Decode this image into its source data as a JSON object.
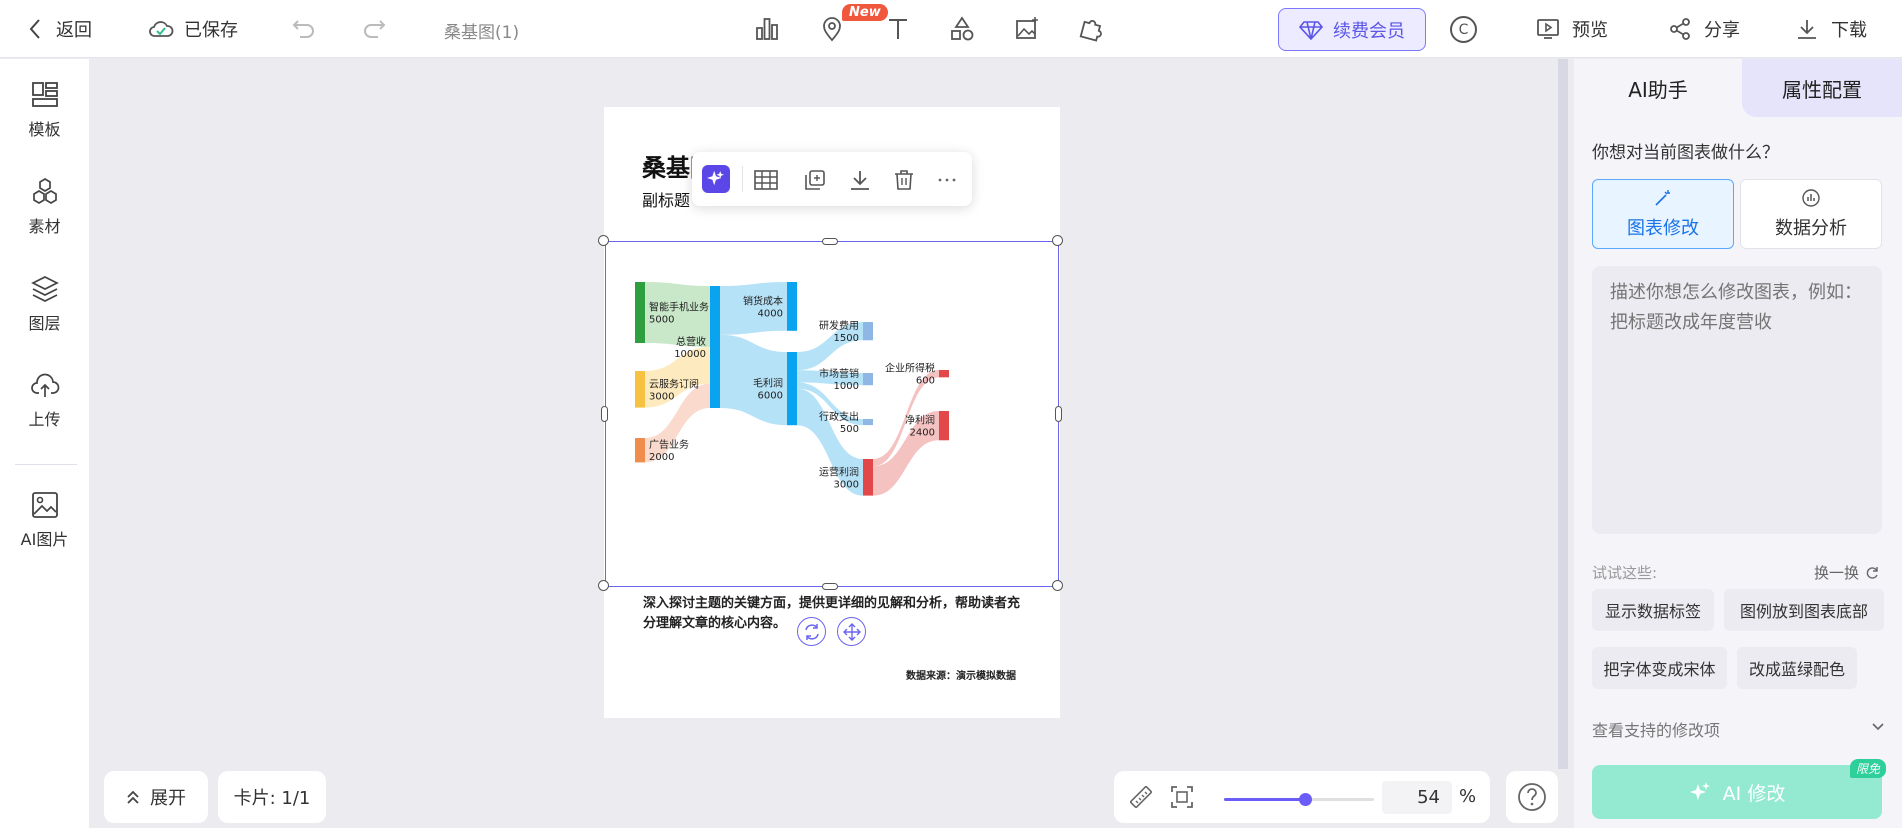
{
  "topbar": {
    "back_label": "返回",
    "saved_label": "已保存",
    "doc_name": "桑基图(1)",
    "new_badge": "New",
    "vip_label": "续费会员",
    "copyright_symbol": "C",
    "preview_label": "预览",
    "share_label": "分享",
    "download_label": "下载",
    "tools": [
      "chart-icon",
      "map-pin-icon",
      "text-icon",
      "shapes-icon",
      "image-add-icon",
      "puzzle-icon"
    ]
  },
  "sidebar": {
    "items": [
      {
        "label": "模板",
        "icon": "template-icon"
      },
      {
        "label": "素材",
        "icon": "hexagons-icon"
      },
      {
        "label": "图层",
        "icon": "layers-icon"
      },
      {
        "label": "上传",
        "icon": "cloud-upload-icon"
      },
      {
        "label": "AI图片",
        "icon": "image-icon"
      }
    ]
  },
  "canvas": {
    "title": "桑基图",
    "subtitle": "副标题",
    "description": "深入探讨主题的关键方面，提供更详细的见解和分析，帮助读者充分理解文章的核心内容。",
    "source": "数据来源：演示模拟数据"
  },
  "chart_data": {
    "type": "sankey",
    "title": "桑基图",
    "subtitle": "副标题",
    "nodes": [
      {
        "name": "智能手机业务",
        "value": 5000,
        "color": "#2e9e3e"
      },
      {
        "name": "云服务订阅",
        "value": 3000,
        "color": "#f7c242"
      },
      {
        "name": "广告业务",
        "value": 2000,
        "color": "#ef8d4e"
      },
      {
        "name": "总营收",
        "value": 10000,
        "color": "#0aa3ef"
      },
      {
        "name": "销货成本",
        "value": 4000,
        "color": "#0aa3ef"
      },
      {
        "name": "毛利润",
        "value": 6000,
        "color": "#0aa3ef"
      },
      {
        "name": "研发费用",
        "value": 1500,
        "color": "#8fb7e6"
      },
      {
        "name": "市场营销",
        "value": 1000,
        "color": "#8fb7e6"
      },
      {
        "name": "行政支出",
        "value": 500,
        "color": "#8fb7e6"
      },
      {
        "name": "运营利润",
        "value": 3000,
        "color": "#e2474a"
      },
      {
        "name": "企业所得税",
        "value": 600,
        "color": "#e2474a"
      },
      {
        "name": "净利润",
        "value": 2400,
        "color": "#e2474a"
      }
    ],
    "links": [
      {
        "source": "智能手机业务",
        "target": "总营收",
        "value": 5000
      },
      {
        "source": "云服务订阅",
        "target": "总营收",
        "value": 3000
      },
      {
        "source": "广告业务",
        "target": "总营收",
        "value": 2000
      },
      {
        "source": "总营收",
        "target": "销货成本",
        "value": 4000
      },
      {
        "source": "总营收",
        "target": "毛利润",
        "value": 6000
      },
      {
        "source": "毛利润",
        "target": "研发费用",
        "value": 1500
      },
      {
        "source": "毛利润",
        "target": "市场营销",
        "value": 1000
      },
      {
        "source": "毛利润",
        "target": "行政支出",
        "value": 500
      },
      {
        "source": "毛利润",
        "target": "运营利润",
        "value": 3000
      },
      {
        "source": "运营利润",
        "target": "企业所得税",
        "value": 600
      },
      {
        "source": "运营利润",
        "target": "净利润",
        "value": 2400
      }
    ]
  },
  "bottombar": {
    "expand_label": "展开",
    "card_label": "卡片: 1/1",
    "zoom_value": "54",
    "zoom_fraction": 0.54,
    "zoom_unit": "%"
  },
  "rightpanel": {
    "tab_ai": "AI助手",
    "tab_props": "属性配置",
    "question": "你想对当前图表做什么？",
    "mode_edit": "图表修改",
    "mode_analyze": "数据分析",
    "prompt_placeholder": "描述你想怎么修改图表，例如：把标题改成年度营收",
    "try_label": "试试这些:",
    "refresh_label": "换一换",
    "suggestions": [
      "显示数据标签",
      "图例放到图表底部",
      "把字体变成宋体",
      "改成蓝绿配色"
    ],
    "support_label": "查看支持的修改项",
    "ai_modify_label": "AI 修改",
    "limit_badge": "限免"
  },
  "colors": {
    "accent": "#6b66f0",
    "ai_button": "#93ead0",
    "edit_mode_border": "#5aa9ff"
  }
}
